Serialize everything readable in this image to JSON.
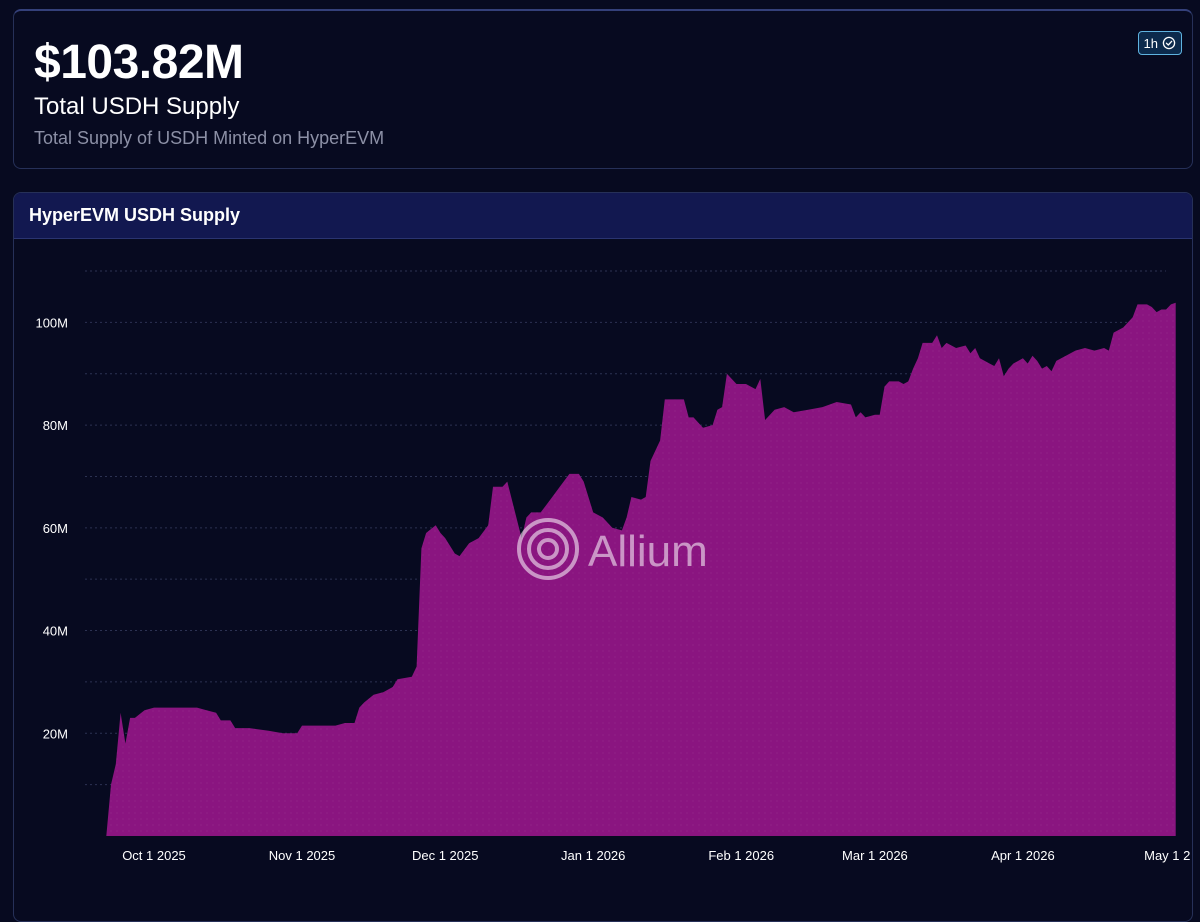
{
  "kpi": {
    "value": "$103.82M",
    "title": "Total USDH Supply",
    "subtitle": "Total Supply of USDH Minted on HyperEVM",
    "refresh": {
      "label": "1h",
      "icon": "check-circle-icon"
    }
  },
  "chart": {
    "title": "HyperEVM USDH Supply",
    "watermark": "Allium"
  },
  "colors": {
    "background": "#070a20",
    "header": "#121850",
    "area": "#8a1580",
    "grid": "#2c3252",
    "badge_border": "#5fb3e0"
  },
  "chart_data": {
    "type": "area",
    "title": "HyperEVM USDH Supply",
    "xlabel": "",
    "ylabel": "",
    "ylim": [
      0,
      110
    ],
    "y_unit": "M",
    "grid": true,
    "legend": "none",
    "x_ticks": [
      "Oct 1 2025",
      "Nov 1 2025",
      "Dec 1 2025",
      "Jan 1 2026",
      "Feb 1 2026",
      "Mar 1 2026",
      "Apr 1 2026",
      "May 1 2"
    ],
    "y_ticks": [
      "20M",
      "40M",
      "60M",
      "80M",
      "100M"
    ],
    "y_tick_values": [
      20,
      40,
      60,
      80,
      100
    ],
    "series": [
      {
        "values": [
          [
            "2025-09-21",
            0
          ],
          [
            "2025-09-22",
            10
          ],
          [
            "2025-09-23",
            14
          ],
          [
            "2025-09-24",
            24
          ],
          [
            "2025-09-25",
            18
          ],
          [
            "2025-09-26",
            23
          ],
          [
            "2025-09-27",
            23
          ],
          [
            "2025-09-29",
            24.5
          ],
          [
            "2025-10-01",
            25
          ],
          [
            "2025-10-05",
            25
          ],
          [
            "2025-10-10",
            25
          ],
          [
            "2025-10-12",
            24.5
          ],
          [
            "2025-10-14",
            24
          ],
          [
            "2025-10-15",
            22.5
          ],
          [
            "2025-10-17",
            22.5
          ],
          [
            "2025-10-18",
            21
          ],
          [
            "2025-10-21",
            21
          ],
          [
            "2025-10-25",
            20.5
          ],
          [
            "2025-10-28",
            20
          ],
          [
            "2025-10-31",
            20
          ],
          [
            "2025-11-01",
            21.5
          ],
          [
            "2025-11-05",
            21.5
          ],
          [
            "2025-11-08",
            21.5
          ],
          [
            "2025-11-10",
            22
          ],
          [
            "2025-11-12",
            22
          ],
          [
            "2025-11-13",
            25
          ],
          [
            "2025-11-14",
            26
          ],
          [
            "2025-11-16",
            27.5
          ],
          [
            "2025-11-18",
            28
          ],
          [
            "2025-11-20",
            29
          ],
          [
            "2025-11-21",
            30.5
          ],
          [
            "2025-11-24",
            31
          ],
          [
            "2025-11-25",
            33
          ],
          [
            "2025-11-26",
            56
          ],
          [
            "2025-11-27",
            59
          ],
          [
            "2025-11-29",
            60.5
          ],
          [
            "2025-11-30",
            59
          ],
          [
            "2025-12-01",
            58
          ],
          [
            "2025-12-03",
            55
          ],
          [
            "2025-12-04",
            54.5
          ],
          [
            "2025-12-06",
            57
          ],
          [
            "2025-12-08",
            58
          ],
          [
            "2025-12-10",
            60.5
          ],
          [
            "2025-12-11",
            68
          ],
          [
            "2025-12-13",
            68
          ],
          [
            "2025-12-14",
            69
          ],
          [
            "2025-12-17",
            58
          ],
          [
            "2025-12-18",
            62
          ],
          [
            "2025-12-19",
            63
          ],
          [
            "2025-12-21",
            63
          ],
          [
            "2025-12-23",
            65.5
          ],
          [
            "2025-12-25",
            68
          ],
          [
            "2025-12-27",
            70.5
          ],
          [
            "2025-12-29",
            70.5
          ],
          [
            "2025-12-30",
            69
          ],
          [
            "2026-01-01",
            63
          ],
          [
            "2026-01-03",
            62
          ],
          [
            "2026-01-05",
            60
          ],
          [
            "2026-01-07",
            59.5
          ],
          [
            "2026-01-08",
            62
          ],
          [
            "2026-01-09",
            66
          ],
          [
            "2026-01-11",
            65.5
          ],
          [
            "2026-01-12",
            66
          ],
          [
            "2026-01-13",
            73
          ],
          [
            "2026-01-15",
            77
          ],
          [
            "2026-01-16",
            85
          ],
          [
            "2026-01-18",
            85
          ],
          [
            "2026-01-20",
            85
          ],
          [
            "2026-01-21",
            81.5
          ],
          [
            "2026-01-22",
            81.5
          ],
          [
            "2026-01-24",
            79.5
          ],
          [
            "2026-01-26",
            80
          ],
          [
            "2026-01-27",
            83
          ],
          [
            "2026-01-28",
            83.5
          ],
          [
            "2026-01-29",
            90
          ],
          [
            "2026-01-30",
            89
          ],
          [
            "2026-01-31",
            88
          ],
          [
            "2026-02-02",
            88
          ],
          [
            "2026-02-04",
            87
          ],
          [
            "2026-02-05",
            89
          ],
          [
            "2026-02-06",
            81
          ],
          [
            "2026-02-08",
            83
          ],
          [
            "2026-02-10",
            83.5
          ],
          [
            "2026-02-12",
            82.5
          ],
          [
            "2026-02-15",
            83
          ],
          [
            "2026-02-18",
            83.5
          ],
          [
            "2026-02-21",
            84.5
          ],
          [
            "2026-02-24",
            84
          ],
          [
            "2026-02-25",
            81.5
          ],
          [
            "2026-02-26",
            82.5
          ],
          [
            "2026-02-27",
            81.5
          ],
          [
            "2026-03-01",
            82
          ],
          [
            "2026-03-02",
            82
          ],
          [
            "2026-03-03",
            87.5
          ],
          [
            "2026-03-04",
            88.5
          ],
          [
            "2026-03-06",
            88.5
          ],
          [
            "2026-03-07",
            88
          ],
          [
            "2026-03-08",
            88.5
          ],
          [
            "2026-03-09",
            91
          ],
          [
            "2026-03-10",
            93
          ],
          [
            "2026-03-11",
            96
          ],
          [
            "2026-03-13",
            96
          ],
          [
            "2026-03-14",
            97.5
          ],
          [
            "2026-03-15",
            95
          ],
          [
            "2026-03-16",
            96
          ],
          [
            "2026-03-18",
            95
          ],
          [
            "2026-03-20",
            95.5
          ],
          [
            "2026-03-21",
            94
          ],
          [
            "2026-03-22",
            95
          ],
          [
            "2026-03-23",
            93
          ],
          [
            "2026-03-25",
            92
          ],
          [
            "2026-03-26",
            91.5
          ],
          [
            "2026-03-27",
            93
          ],
          [
            "2026-03-28",
            89.5
          ],
          [
            "2026-03-29",
            91
          ],
          [
            "2026-03-30",
            92
          ],
          [
            "2026-04-01",
            93
          ],
          [
            "2026-04-02",
            92
          ],
          [
            "2026-04-03",
            93.5
          ],
          [
            "2026-04-04",
            92.5
          ],
          [
            "2026-04-05",
            91
          ],
          [
            "2026-04-06",
            91.5
          ],
          [
            "2026-04-07",
            90.5
          ],
          [
            "2026-04-08",
            92.5
          ],
          [
            "2026-04-10",
            93.5
          ],
          [
            "2026-04-12",
            94.5
          ],
          [
            "2026-04-14",
            95
          ],
          [
            "2026-04-16",
            94.5
          ],
          [
            "2026-04-18",
            95
          ],
          [
            "2026-04-19",
            94.5
          ],
          [
            "2026-04-20",
            98
          ],
          [
            "2026-04-22",
            99
          ],
          [
            "2026-04-24",
            101
          ],
          [
            "2026-04-25",
            103.5
          ],
          [
            "2026-04-27",
            103.5
          ],
          [
            "2026-04-28",
            103
          ],
          [
            "2026-04-29",
            102
          ],
          [
            "2026-04-30",
            102.5
          ],
          [
            "2026-05-01",
            102.5
          ],
          [
            "2026-05-02",
            103.5
          ],
          [
            "2026-05-03",
            103.8
          ]
        ]
      }
    ]
  }
}
